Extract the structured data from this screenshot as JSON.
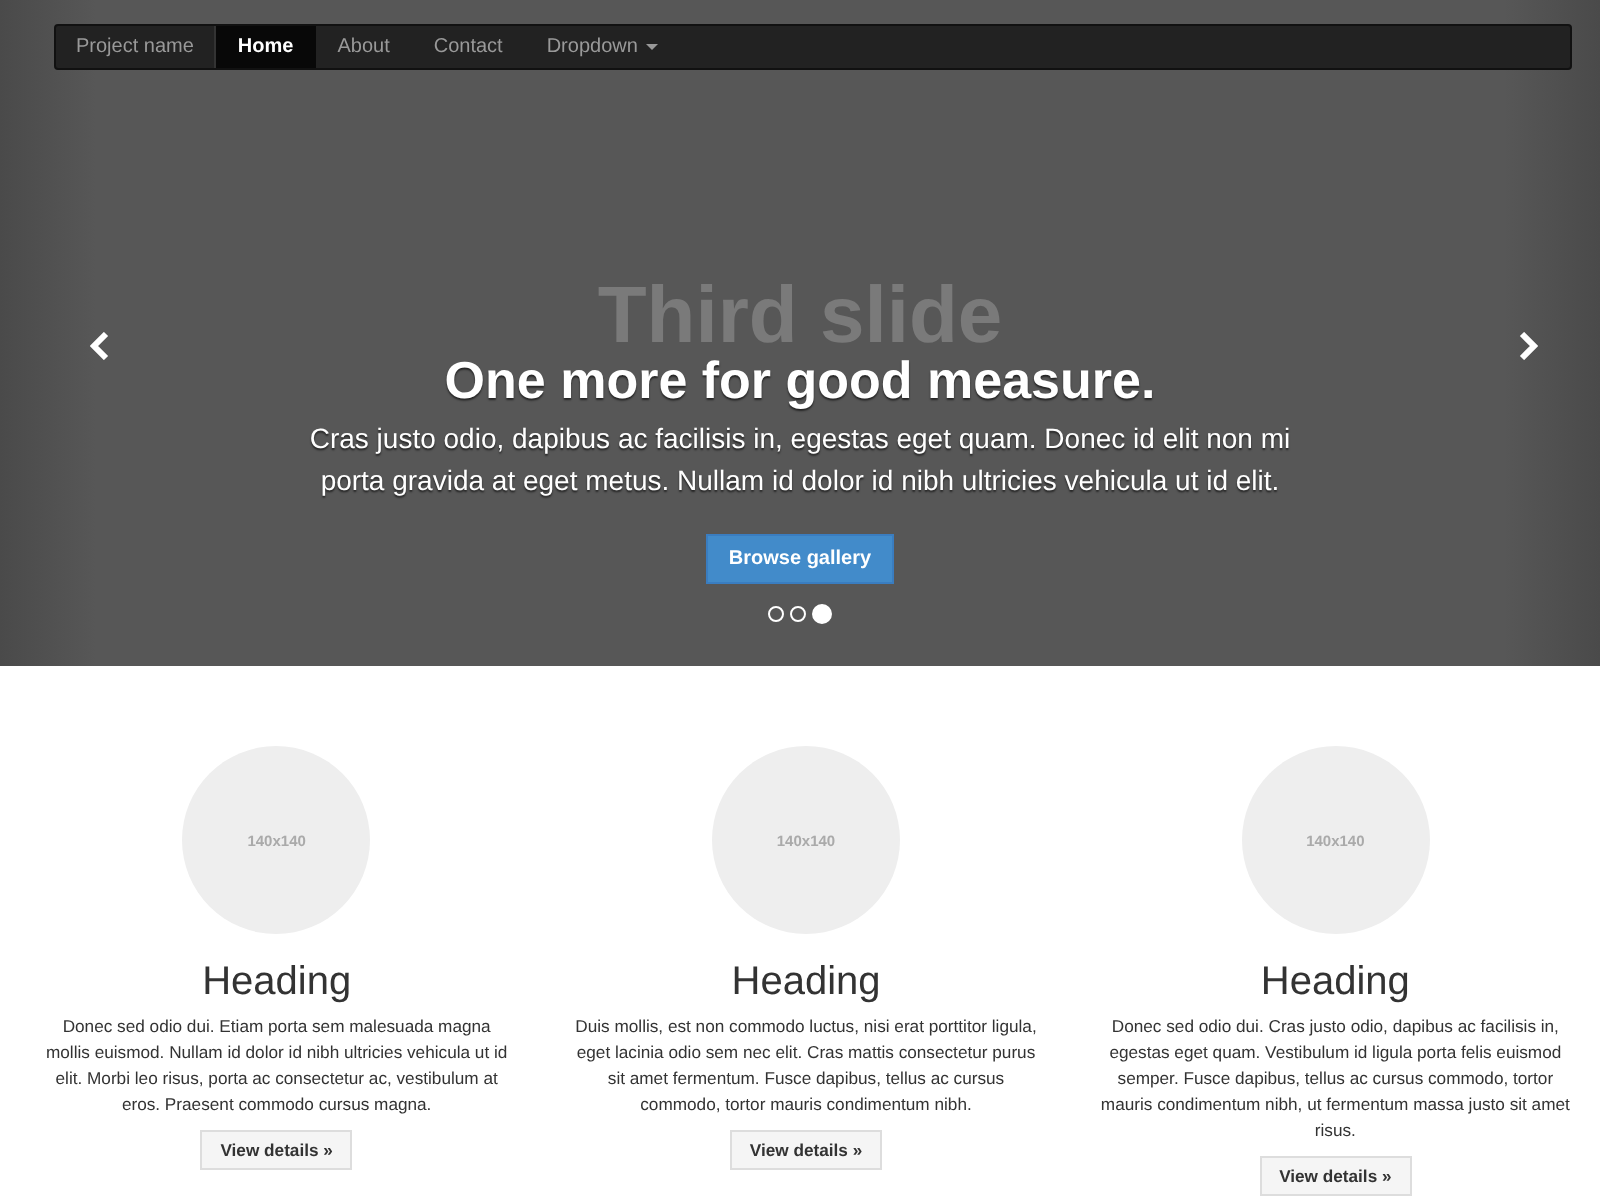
{
  "navbar": {
    "brand": "Project name",
    "items": [
      {
        "label": "Home",
        "selected": true,
        "kind": "link"
      },
      {
        "label": "About",
        "selected": false,
        "kind": "link"
      },
      {
        "label": "Contact",
        "selected": false,
        "kind": "link"
      },
      {
        "label": "Dropdown",
        "selected": false,
        "kind": "dropdown"
      }
    ]
  },
  "carousel": {
    "background_text": "Third slide",
    "heading": "One more for good measure.",
    "text": "Cras justo odio, dapibus ac facilisis in, egestas eget quam. Donec id elit non mi porta gravida at eget metus. Nullam id dolor id nibh ultricies vehicula ut id elit.",
    "button": "Browse gallery",
    "indicators": [
      {
        "selected": false
      },
      {
        "selected": false
      },
      {
        "selected": true
      }
    ]
  },
  "columns": [
    {
      "image_label": "140x140",
      "heading": "Heading",
      "text": "Donec sed odio dui. Etiam porta sem malesuada magna mollis euismod. Nullam id dolor id nibh ultricies vehicula ut id elit. Morbi leo risus, porta ac consectetur ac, vestibulum at eros. Praesent commodo cursus magna.",
      "button": "View details »"
    },
    {
      "image_label": "140x140",
      "heading": "Heading",
      "text": "Duis mollis, est non commodo luctus, nisi erat porttitor ligula, eget lacinia odio sem nec elit. Cras mattis consectetur purus sit amet fermentum. Fusce dapibus, tellus ac cursus commodo, tortor mauris condimentum nibh.",
      "button": "View details »"
    },
    {
      "image_label": "140x140",
      "heading": "Heading",
      "text": "Donec sed odio dui. Cras justo odio, dapibus ac facilisis in, egestas eget quam. Vestibulum id ligula porta felis euismod semper. Fusce dapibus, tellus ac cursus commodo, tortor mauris condimentum nibh, ut fermentum massa justo sit amet risus.",
      "button": "View details »"
    }
  ]
}
